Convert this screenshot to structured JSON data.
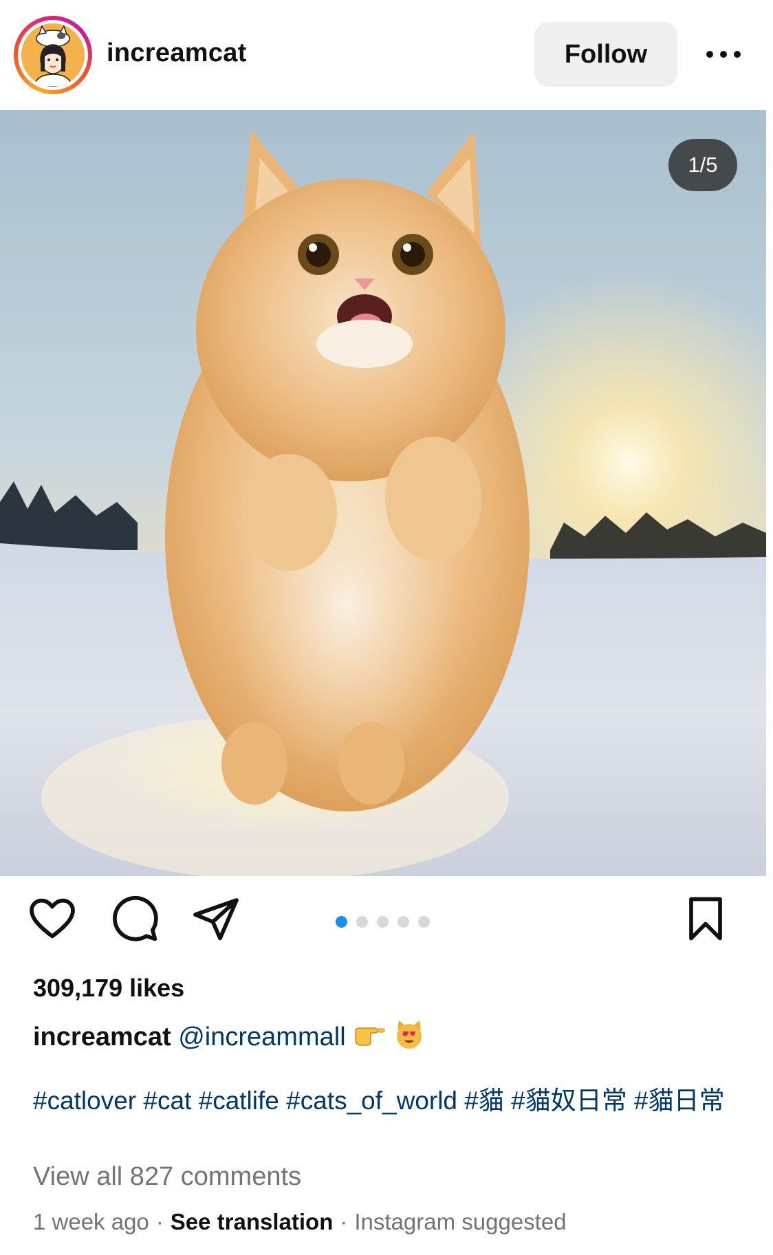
{
  "post": {
    "username": "increamcat",
    "follow_label": "Follow",
    "image_counter": "1/5",
    "carousel": {
      "count": 5,
      "active_index": 0
    },
    "likes": "309,179 likes",
    "caption": {
      "username": "increamcat",
      "mention": "@increammall",
      "emojis": [
        "pointing-hand-emoji",
        "heart-eyes-cat-emoji"
      ]
    },
    "hashtags": "#catlover #cat #catlife #cats_of_world #貓 #貓奴日常 #貓日常",
    "view_comments": "View all 827 comments",
    "time_ago": "1 week ago",
    "see_translation": "See translation",
    "suggested": "Instagram suggested"
  },
  "colors": {
    "link": "#00376b",
    "muted": "#737373",
    "active_dot": "#1c8ef0",
    "follow_bg": "#efefef"
  },
  "icons": [
    "more-icon",
    "heart-icon",
    "comment-icon",
    "share-icon",
    "bookmark-icon"
  ]
}
